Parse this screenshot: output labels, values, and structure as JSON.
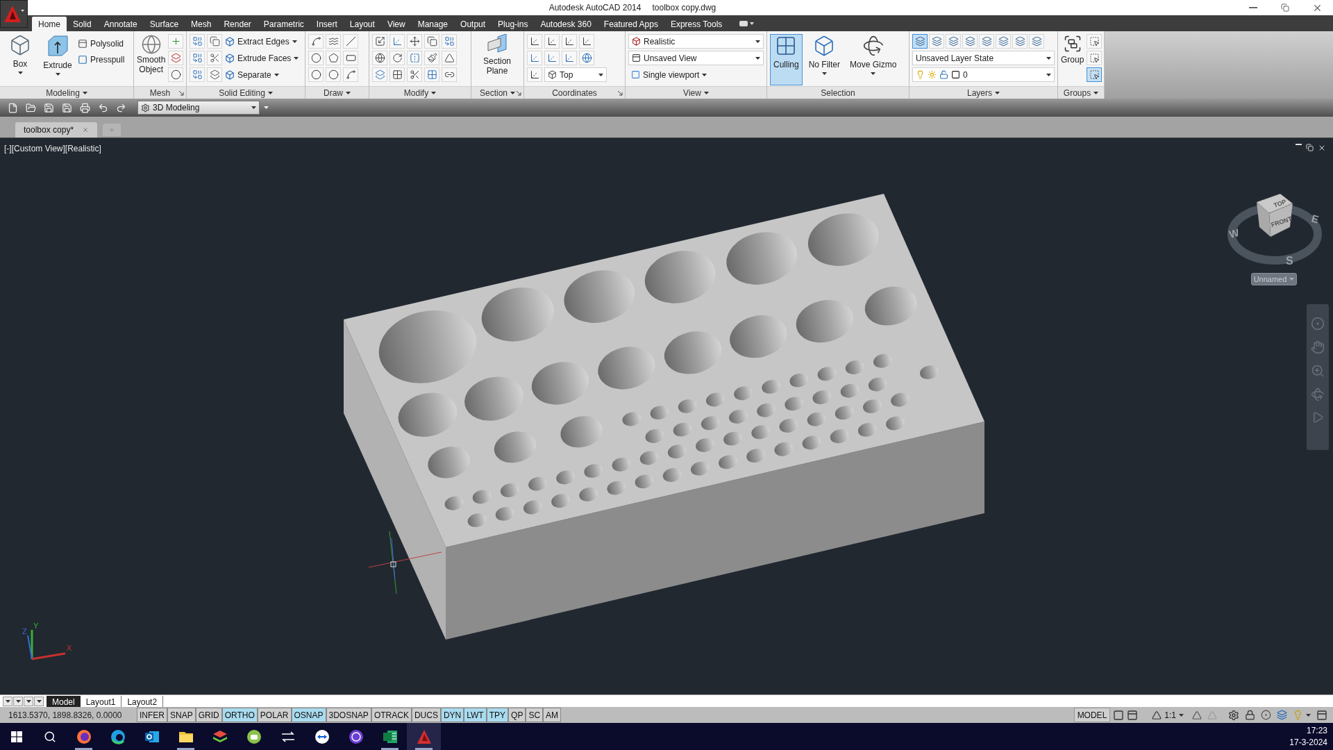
{
  "window": {
    "app_name": "Autodesk AutoCAD 2014",
    "file_name": "toolbox copy.dwg"
  },
  "ribbon_tabs": [
    {
      "label": "Home",
      "selected": true
    },
    {
      "label": "Solid",
      "selected": false
    },
    {
      "label": "Annotate",
      "selected": false
    },
    {
      "label": "Surface",
      "selected": false
    },
    {
      "label": "Mesh",
      "selected": false
    },
    {
      "label": "Render",
      "selected": false
    },
    {
      "label": "Parametric",
      "selected": false
    },
    {
      "label": "Insert",
      "selected": false
    },
    {
      "label": "Layout",
      "selected": false
    },
    {
      "label": "View",
      "selected": false
    },
    {
      "label": "Manage",
      "selected": false
    },
    {
      "label": "Output",
      "selected": false
    },
    {
      "label": "Plug-ins",
      "selected": false
    },
    {
      "label": "Autodesk 360",
      "selected": false
    },
    {
      "label": "Featured Apps",
      "selected": false
    },
    {
      "label": "Express Tools",
      "selected": false
    }
  ],
  "ribbon": {
    "modeling": {
      "label": "Modeling",
      "menu": true,
      "launcher": false,
      "large_tools": [
        {
          "label": "Box"
        },
        {
          "label": "Extrude"
        }
      ],
      "small_tools": [
        {
          "label": "Polysolid"
        },
        {
          "label": "Presspull"
        }
      ]
    },
    "mesh": {
      "label": "Mesh",
      "menu": false,
      "launcher": true,
      "large_tool": "Smooth Object"
    },
    "solid_editing": {
      "label": "Solid Editing",
      "menu": true,
      "launcher": false,
      "tools": [
        {
          "label": "Extract Edges"
        },
        {
          "label": "Extrude Faces"
        },
        {
          "label": "Separate"
        }
      ]
    },
    "draw": {
      "label": "Draw",
      "menu": true,
      "launcher": false
    },
    "modify": {
      "label": "Modify",
      "menu": true,
      "launcher": false
    },
    "section": {
      "label": "Section",
      "menu": true,
      "launcher": true,
      "large_tool": "Section Plane"
    },
    "coordinates": {
      "label": "Coordinates",
      "menu": false,
      "launcher": true,
      "view_dropdown": "Top"
    },
    "view": {
      "label": "View",
      "menu": true,
      "launcher": false,
      "visual_style": "Realistic",
      "named_view": "Unsaved View",
      "viewport_config": "Single viewport"
    },
    "selection": {
      "label": "Selection",
      "menu": false,
      "launcher": false,
      "tools": [
        {
          "label": "Culling",
          "selected": true
        },
        {
          "label": "No Filter",
          "selected": false
        },
        {
          "label": "Move Gizmo",
          "selected": false
        }
      ]
    },
    "layers": {
      "label": "Layers",
      "menu": true,
      "launcher": false,
      "tools": [
        {
          "selected": true
        },
        {
          "selected": false
        },
        {
          "selected": false
        },
        {
          "selected": false
        },
        {
          "selected": false
        },
        {
          "selected": false
        },
        {
          "selected": false
        },
        {
          "selected": false
        }
      ],
      "layer_state": "Unsaved Layer State",
      "current_layer": "0"
    },
    "groups": {
      "label": "Groups",
      "menu": true,
      "launcher": false,
      "large_tool": "Group",
      "tools": [
        {
          "selected": false
        },
        {
          "selected": false
        },
        {
          "selected": true
        }
      ]
    }
  },
  "quick_access": {
    "workspace": "3D Modeling"
  },
  "document_tabs": [
    {
      "label": "toolbox copy*",
      "selected": true
    }
  ],
  "viewport": {
    "label": "[-][Custom View][Realistic]",
    "viewcube": {
      "top": "TOP",
      "front": "FRONT",
      "west": "W",
      "east": "E",
      "south": "S",
      "ucs_menu": "Unnamed"
    },
    "ucs": {
      "x": "X",
      "y": "Y",
      "z": "Z"
    }
  },
  "layout_tabs": [
    {
      "label": "Model",
      "selected": true
    },
    {
      "label": "Layout1",
      "selected": false
    },
    {
      "label": "Layout2",
      "selected": false
    }
  ],
  "status_bar": {
    "coordinates": "1613.5370, 1898.8326, 0.0000",
    "toggles": [
      {
        "label": "INFER",
        "on": false
      },
      {
        "label": "SNAP",
        "on": false
      },
      {
        "label": "GRID",
        "on": false
      },
      {
        "label": "ORTHO",
        "on": true
      },
      {
        "label": "POLAR",
        "on": false
      },
      {
        "label": "OSNAP",
        "on": true
      },
      {
        "label": "3DOSNAP",
        "on": false
      },
      {
        "label": "OTRACK",
        "on": false
      },
      {
        "label": "DUCS",
        "on": false
      },
      {
        "label": "DYN",
        "on": true
      },
      {
        "label": "LWT",
        "on": true
      },
      {
        "label": "TPY",
        "on": true
      },
      {
        "label": "QP",
        "on": false
      },
      {
        "label": "SC",
        "on": false
      },
      {
        "label": "AM",
        "on": false
      }
    ],
    "space": "MODEL",
    "annotation_scale": "1:1"
  },
  "taskbar": {
    "apps": [
      {
        "kind": "fox",
        "open": true,
        "selected": false
      },
      {
        "kind": "edge",
        "open": false,
        "selected": false
      },
      {
        "kind": "mail",
        "open": false,
        "selected": false
      },
      {
        "kind": "folder",
        "open": true,
        "selected": false
      },
      {
        "kind": "stack",
        "open": false,
        "selected": false
      },
      {
        "kind": "disc",
        "open": false,
        "selected": false
      },
      {
        "kind": "arrows",
        "open": false,
        "selected": false
      },
      {
        "kind": "remote",
        "open": false,
        "selected": false
      },
      {
        "kind": "badge",
        "open": false,
        "selected": false
      },
      {
        "kind": "sheet",
        "open": true,
        "selected": false
      },
      {
        "kind": "cad",
        "open": true,
        "selected": true
      }
    ],
    "time": "17:23",
    "date": "17-3-2024"
  }
}
